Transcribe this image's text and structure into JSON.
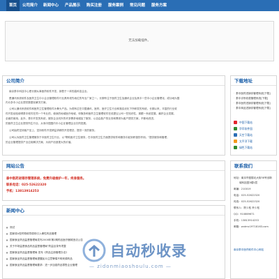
{
  "nav": {
    "items": [
      "首页",
      "公司简介",
      "新闻中心",
      "产品展示",
      "购买注册",
      "服务案例",
      "常见问题",
      "服务方案"
    ]
  },
  "banner": {
    "text": "无法加载插件。"
  },
  "about": {
    "title": "公司简介",
    "paragraphs": [
      "南京泰中科技中心是长期从事医药软件开发、销售于一体的高科技企业。",
      "是通讯系统软件及医药卫生中小企业管理软件行业具有领先地位的专业厂家之一。长期专注于医药卫生及通讯企业及其中一些中小企业管理化，成功地为国",
      "内众多中小企业提供数据化解决方案。",
      "公司以通讯系统软件和医药卫生管理软件为骨头产品。为现有过在中国通讯、医药、医疗卫生行业和落实优化下所研发的系统。长期以来，丰富的行业软",
      "件开发经验使得泰中软件在同一个专业的，使我的地域医疗地域，伴随多种医药卫生管理软件在线提议公司一些知识性，紧跟一系统发展，最好企业发展，",
      "全面的使用。此外，泰中开发的系统，服务企业向外的许多需求地增加了服务，以自由各户的业务和需求为客户提供方案，不断地改进，",
      "的医药卫生企业提供所生行业、从而中国国内中小企业管理企业共同发展。",
      "公司始终坚持客户至上，坚持软件开发精益求精的开发理念，提供一流的服务。",
      "公司以为医药卫生管理服务于中医药卫生行业，以\"帮助医疗卫生服务，在中医药卫生方面提供软件和服务中起到积极的作用。\"提供服务和管理，",
      "的企业管理提供产业应用解决方案，为用户创造更大的价值。"
    ]
  },
  "downloads": {
    "title": "下载地址",
    "list": [
      "泰中医药进销存管理系统[下载]",
      "泰中诊所收费管理系统[下载]",
      "泰中医药进销存管理系统[下载]",
      "泰中商品进销存管理系统[下载]"
    ],
    "links": [
      {
        "label": "中国下载站",
        "color": "#e3262e"
      },
      {
        "label": "华军软件园",
        "color": "#2f8b2f"
      },
      {
        "label": "天空下载站",
        "color": "#2a6eb5"
      },
      {
        "label": "太平洋下载",
        "color": "#f29a1c"
      },
      {
        "label": "绿色下载站",
        "color": "#2f8b2f"
      }
    ]
  },
  "notice": {
    "title": "网站公告",
    "lines": [
      "泰中医药进销存管理系统，免费升级维护一年，终身服务。",
      "联系电话：025-52622320",
      "手机：13813914253"
    ]
  },
  "news": {
    "title": "新闻中心",
    "items": [
      "测试",
      "国家将A型药物疏导原则引入牵性药品管理",
      "国家食品药品监督管理局发布2008年第2期药品医疗器械违法公告",
      "关于市场监督食品药品监督管理局\"药监目录专项整",
      "国家食品药品监督管理局 发布《药品注册管理办法》",
      "国家食品药品监督管理局提醒民众注意警惕不明来源药品",
      "国家食品药品监督管理局要求：进一步加强药品零售企业管理"
    ]
  },
  "contact": {
    "title": "联系我们",
    "lines": [
      "地址：南京市鼓楼北大街58号创新",
      "城科技园3幢5层",
      "邮编：210019",
      "电话：025-52622320",
      "传真：025-52622320",
      "联系人：陈少松  乔少松",
      "QQ：910869671",
      "手机：13813914253",
      "邮箱：wxtmc19718163.com"
    ],
    "more": "南京泰中医药软件中心网站"
  },
  "watermark": {
    "title": "自动秒收录",
    "sub": "— zidonmiaoshoulu.com —"
  }
}
